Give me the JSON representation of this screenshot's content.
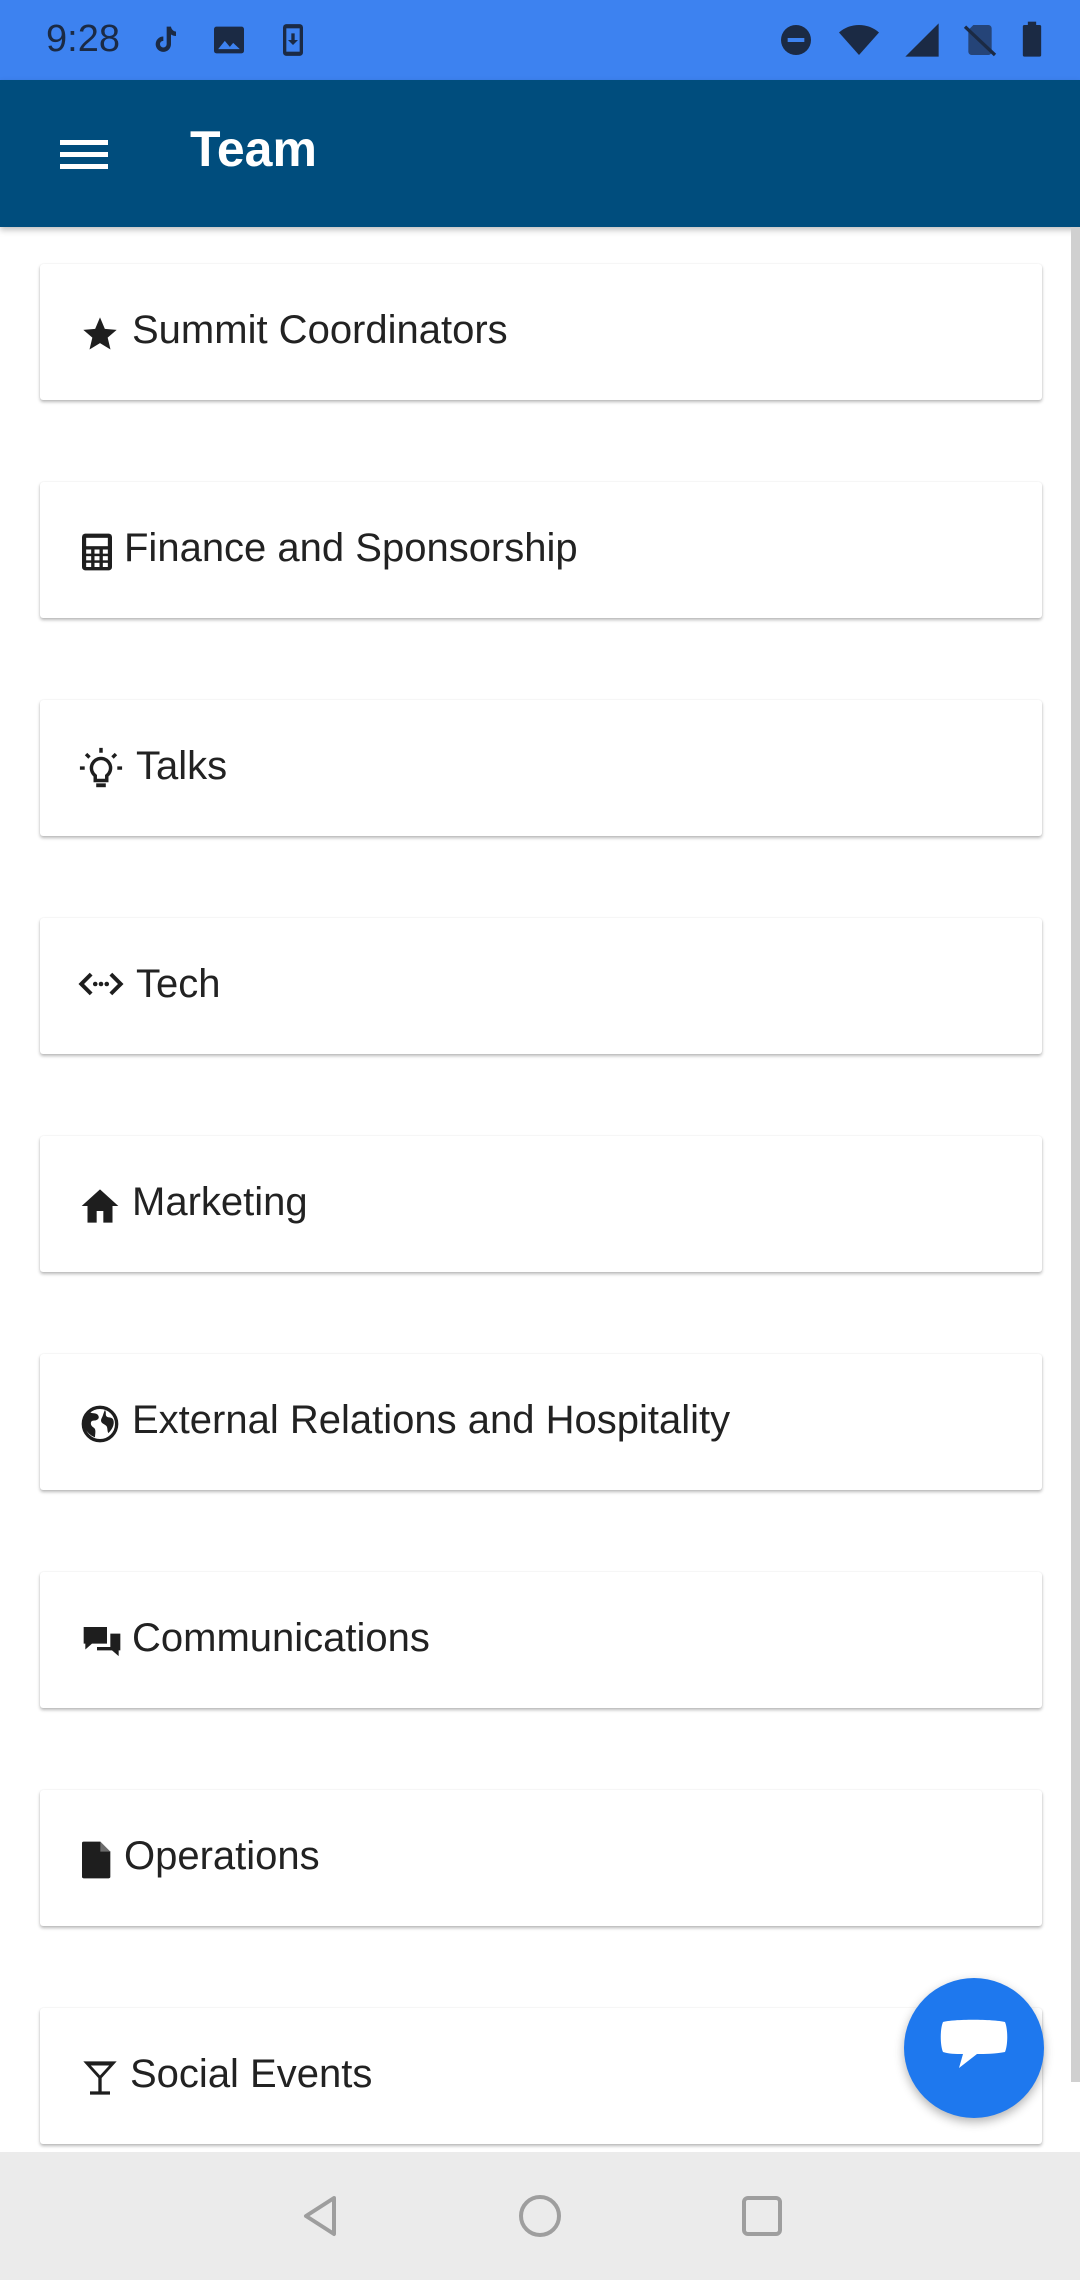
{
  "status_bar": {
    "time": "9:28",
    "left_icons": [
      "tiktok-icon",
      "image-icon",
      "download-icon"
    ],
    "right_icons": [
      "do-not-disturb-icon",
      "wifi-icon",
      "signal-icon",
      "no-sim-icon",
      "battery-icon"
    ]
  },
  "app_bar": {
    "menu_icon": "hamburger-menu-icon",
    "title": "Team"
  },
  "teams": [
    {
      "label": "Summit Coordinators",
      "icon": "star-icon"
    },
    {
      "label": "Finance and Sponsorship",
      "icon": "calculator-icon"
    },
    {
      "label": "Talks",
      "icon": "lightbulb-icon"
    },
    {
      "label": "Tech",
      "icon": "code-icon"
    },
    {
      "label": "Marketing",
      "icon": "home-icon"
    },
    {
      "label": "External Relations and Hospitality",
      "icon": "globe-icon"
    },
    {
      "label": "Communications",
      "icon": "chat-bubbles-icon"
    },
    {
      "label": "Operations",
      "icon": "document-icon"
    },
    {
      "label": "Social Events",
      "icon": "cocktail-icon"
    }
  ],
  "fab": {
    "icon": "chat-icon"
  },
  "nav_bar": {
    "buttons": [
      "back-icon",
      "home-circle-icon",
      "recents-icon"
    ]
  },
  "colors": {
    "status_bar": "#3d82f0",
    "app_bar": "#004d7d",
    "fab": "#1e78ee",
    "nav_bar": "#ebebeb"
  }
}
